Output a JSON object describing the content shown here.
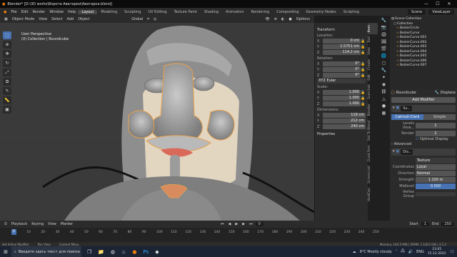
{
  "window": {
    "title": "Blender* [D:\\3D works\\Ворота Аватарки\\Аватарка.blend]",
    "minimize": "—",
    "maximize": "☐",
    "close": "✕"
  },
  "menu": {
    "items": [
      "File",
      "Edit",
      "Render",
      "Window",
      "Help"
    ],
    "workspaces": [
      "Layout",
      "Modeling",
      "Sculpting",
      "UV Editing",
      "Texture Paint",
      "Shading",
      "Animation",
      "Rendering",
      "Compositing",
      "Geometry Nodes",
      "Scripting"
    ],
    "active_workspace": "Layout",
    "scene": "Scene",
    "view_layer": "ViewLayer"
  },
  "viewport_header": {
    "mode": "Object Mode",
    "items": [
      "View",
      "Select",
      "Add",
      "Object"
    ],
    "orientation": "Global",
    "options": "Options"
  },
  "viewport": {
    "perspective": "User Perspective",
    "collection": "(0) Collection | Roundcube",
    "tools": [
      "cursor",
      "move",
      "rotate",
      "scale",
      "transform",
      "annotate",
      "measure",
      "add"
    ]
  },
  "npanel": {
    "transform": "Transform",
    "location": "Location:",
    "loc": {
      "x": "0 cm",
      "y": "1.5751 cm",
      "z": "114.2 cm"
    },
    "rotation": "Rotation:",
    "rot": {
      "x": "0°",
      "y": "0°",
      "z": "0°"
    },
    "rotation_mode": "XYZ Euler",
    "scale": "Scale:",
    "scl": {
      "x": "1.000",
      "y": "1.000",
      "z": "1.000"
    },
    "dimensions": "Dimensions:",
    "dim": {
      "x": "118 cm",
      "y": "212 cm",
      "z": "240 cm"
    },
    "properties": "Properties"
  },
  "side_tabs": [
    "Item",
    "Tool",
    "View",
    "Create",
    "Edit",
    "Sverchok",
    "Blender",
    "Dat To Blend",
    "Quad Rem",
    "Screencast",
    "HardOps"
  ],
  "outliner": {
    "header": "Scene Collection",
    "items": [
      "Collection",
      "BezierCircle",
      "BezierCurve",
      "BezierCurve.001",
      "BezierCurve.002",
      "BezierCurve.003",
      "BezierCurve.004",
      "BezierCurve.005",
      "BezierCurve.006",
      "BezierCurve.007"
    ]
  },
  "properties": {
    "object": "Roundcube",
    "modifier_type": "Displace",
    "add_modifier": "Add Modifier",
    "subsurf": {
      "name": "Su..",
      "mode_catmull": "Catmull-Clark",
      "mode_simple": "Simple",
      "levels_viewport_label": "Levels View...",
      "levels_viewport": "1",
      "render_label": "Render",
      "render": "2",
      "optimal_display": "Optimal Display",
      "advanced": "Advanced"
    },
    "displace": {
      "name": "Dis..",
      "texture": "Texture",
      "coordinates_label": "Coordinates",
      "coordinates": "Local",
      "direction_label": "Direction",
      "direction": "Normal",
      "strength_label": "Strength",
      "strength": "1.100 m",
      "midlevel_label": "Midlevel",
      "midlevel": "0.500",
      "vertex_group_label": "Vertex Group"
    }
  },
  "timeline": {
    "items": [
      "Playback",
      "Keying",
      "View",
      "Marker"
    ],
    "current": "0",
    "start_label": "Start",
    "start": "1",
    "end_label": "End",
    "end": "250",
    "ticks": [
      "0",
      "10",
      "20",
      "30",
      "40",
      "50",
      "60",
      "70",
      "80",
      "90",
      "100",
      "110",
      "120",
      "130",
      "140",
      "150",
      "160",
      "170",
      "180",
      "190",
      "200",
      "210",
      "220",
      "230",
      "240",
      "250"
    ]
  },
  "status": {
    "left": "Set Active Modifier",
    "mid1": "Pan View",
    "mid2": "Context Menu",
    "stats": "Memory: 144.5 MiB | VRAM: 1.1/8.0 GiB | 3.2.2"
  },
  "taskbar": {
    "search": "Введите здесь текст для поиска",
    "weather": "9°C  Mostly cloudy",
    "lang": "ENG",
    "time": "23:05",
    "date": "15.12.2022"
  }
}
